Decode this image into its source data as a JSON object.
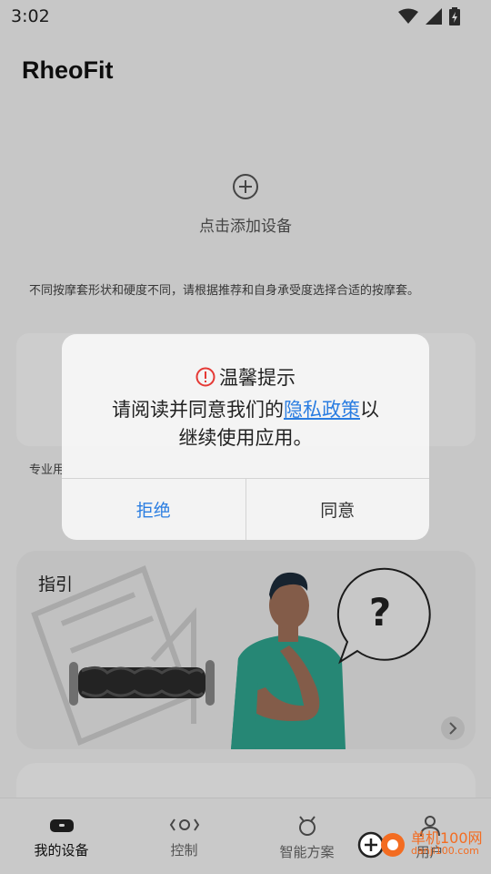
{
  "status_bar": {
    "time": "3:02"
  },
  "app": {
    "title": "RheoFit"
  },
  "add_device": {
    "label": "点击添加设备",
    "icon": "plus-circle-icon"
  },
  "hint": {
    "text": "不同按摩套形状和硬度不同，请根据推荐和自身承受度选择合适的按摩套。"
  },
  "section": {
    "pro_label": "专业用"
  },
  "guide": {
    "title": "指引"
  },
  "dialog": {
    "title": "温馨提示",
    "body_prefix": "请阅读并同意我们的",
    "link_text": "隐私政策",
    "body_mid": "以",
    "body_suffix": "继续使用应用。",
    "reject_label": "拒绝",
    "agree_label": "同意",
    "warning_color": "#e53935",
    "link_color": "#2a7de1"
  },
  "bottom_nav": {
    "items": [
      {
        "label": "我的设备",
        "icon": "device-icon",
        "active": true
      },
      {
        "label": "控制",
        "icon": "control-icon",
        "active": false
      },
      {
        "label": "智能方案",
        "icon": "smart-plan-icon",
        "active": false
      },
      {
        "label": "用户",
        "icon": "user-icon",
        "active": false
      }
    ]
  },
  "watermark": {
    "main": "单机100网",
    "sub": "danji100.com"
  }
}
